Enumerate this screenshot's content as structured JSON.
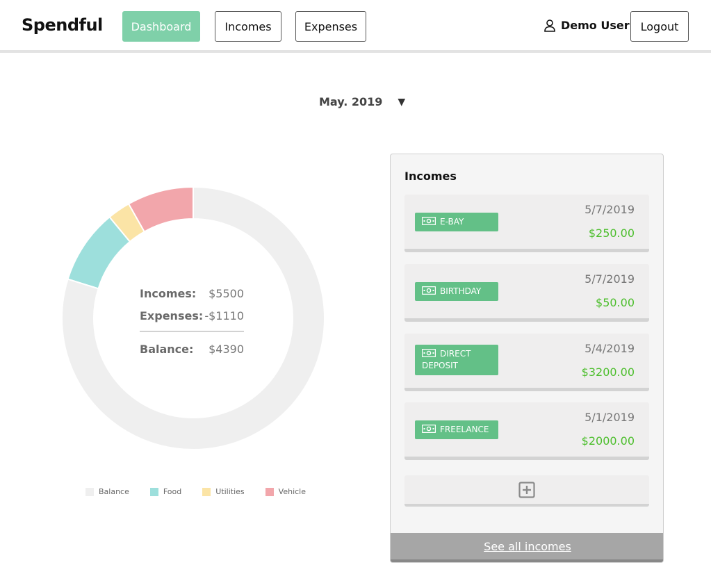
{
  "header": {
    "brand": "Spendful",
    "nav": {
      "dashboard": "Dashboard",
      "incomes": "Incomes",
      "expenses": "Expenses"
    },
    "user_name": "Demo User",
    "logout": "Logout"
  },
  "month_selector": {
    "label": "May. 2019",
    "caret": "▼"
  },
  "summary": {
    "incomes_label": "Incomes:",
    "incomes_value": "$5500",
    "expenses_label": "Expenses:",
    "expenses_value": "-$1110",
    "balance_label": "Balance:",
    "balance_value": "$4390"
  },
  "chart_data": {
    "type": "pie",
    "categories": [
      "Balance",
      "Food",
      "Utilities",
      "Vehicle"
    ],
    "values": [
      4390,
      505,
      155,
      450
    ],
    "colors": [
      "#efefef",
      "#9ddfdc",
      "#fbe4a6",
      "#f2a6ab"
    ],
    "legend_position": "bottom"
  },
  "incomes_panel": {
    "title": "Incomes",
    "items": [
      {
        "name": "E-BAY",
        "date": "5/7/2019",
        "amount": "$250.00"
      },
      {
        "name": "BIRTHDAY",
        "date": "5/7/2019",
        "amount": "$50.00"
      },
      {
        "name": "DIRECT DEPOSIT",
        "date": "5/4/2019",
        "amount": "$3200.00"
      },
      {
        "name": "FREELANCE",
        "date": "5/1/2019",
        "amount": "$2000.00"
      }
    ],
    "see_all": "See all incomes"
  },
  "colors": {
    "accent": "#7fd0a9",
    "tag": "#63c087",
    "income_amount": "#4cbe2c"
  },
  "icons": {
    "user": "user-icon",
    "money": "money-icon",
    "add": "plus-square-icon",
    "caret": "caret-down-icon"
  }
}
